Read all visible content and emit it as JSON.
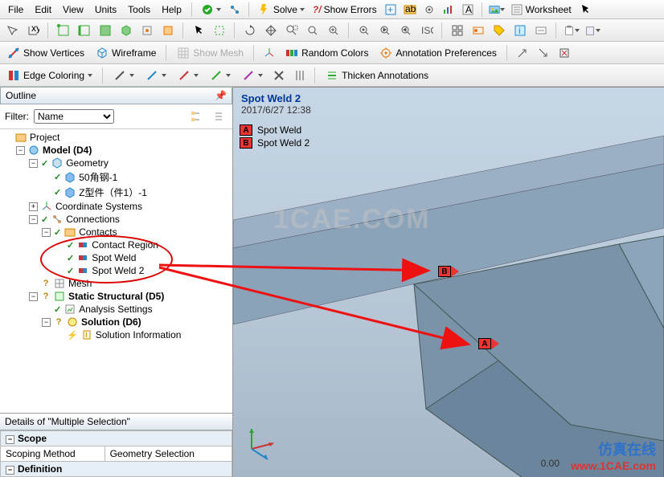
{
  "menu": {
    "file": "File",
    "edit": "Edit",
    "view": "View",
    "units": "Units",
    "tools": "Tools",
    "help": "Help",
    "solve": "Solve",
    "showErrors": "Show Errors",
    "worksheet": "Worksheet"
  },
  "tb2": {
    "showVertices": "Show Vertices",
    "wireframe": "Wireframe",
    "showMesh": "Show Mesh",
    "randomColors": "Random Colors",
    "annotPref": "Annotation Preferences"
  },
  "tb3": {
    "edgeColoring": "Edge Coloring",
    "thicken": "Thicken Annotations"
  },
  "outline": {
    "title": "Outline",
    "filterLabel": "Filter:",
    "filterValue": "Name",
    "project": "Project",
    "model": "Model (D4)",
    "geometry": "Geometry",
    "g1": "50角钢-1",
    "g2": "Z型件（件1）-1",
    "coord": "Coordinate Systems",
    "connections": "Connections",
    "contacts": "Contacts",
    "contactRegion": "Contact Region",
    "spotWeld": "Spot Weld",
    "spotWeld2": "Spot Weld 2",
    "mesh": "Mesh",
    "static": "Static Structural (D5)",
    "analysis": "Analysis Settings",
    "solution": "Solution (D6)",
    "solInfo": "Solution Information"
  },
  "details": {
    "title": "Details of \"Multiple Selection\"",
    "scope": "Scope",
    "scopingMethod": "Scoping Method",
    "scopingVal": "Geometry Selection",
    "definition": "Definition"
  },
  "legend": {
    "t1": "Spot Weld 2",
    "t2": "2017/6/27 12:38",
    "a": "A",
    "b": "B",
    "al": "Spot Weld",
    "bl": "Spot Weld 2"
  },
  "wm": "1CAE.COM",
  "wm2cn": "仿真在线",
  "wm2en": "www.1CAE.com",
  "scale": "0.00"
}
